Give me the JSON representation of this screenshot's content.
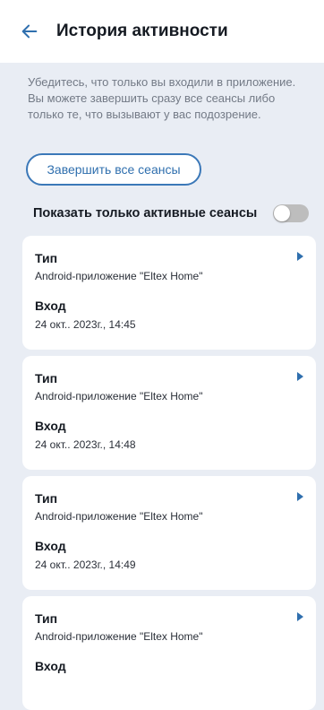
{
  "header": {
    "title": "История активности",
    "back_icon": "arrow-left-icon"
  },
  "description": "Убедитесь, что только вы входили в приложение. Вы можете завершить сразу все сеансы либо только те, что вызывают у вас подозрение.",
  "end_all_button": "Завершить все сеансы",
  "active_toggle": {
    "label": "Показать только активные сеансы",
    "on": false
  },
  "colors": {
    "accent": "#3b78b8",
    "background": "#e9edf4",
    "toggle_off": "#bdbdbd"
  },
  "sessions": [
    {
      "type_label": "Тип",
      "type_value": "Android-приложение \"Eltex Home\"",
      "login_label": "Вход",
      "login_value": "24 окт.. 2023г., 14:45",
      "icon": "play-arrow-icon"
    },
    {
      "type_label": "Тип",
      "type_value": "Android-приложение \"Eltex Home\"",
      "login_label": "Вход",
      "login_value": "24 окт.. 2023г., 14:48",
      "icon": "play-arrow-icon"
    },
    {
      "type_label": "Тип",
      "type_value": "Android-приложение \"Eltex Home\"",
      "login_label": "Вход",
      "login_value": "24 окт.. 2023г., 14:49",
      "icon": "play-arrow-icon"
    },
    {
      "type_label": "Тип",
      "type_value": "Android-приложение \"Eltex Home\"",
      "login_label": "Вход",
      "login_value": "",
      "icon": "play-arrow-icon"
    }
  ]
}
